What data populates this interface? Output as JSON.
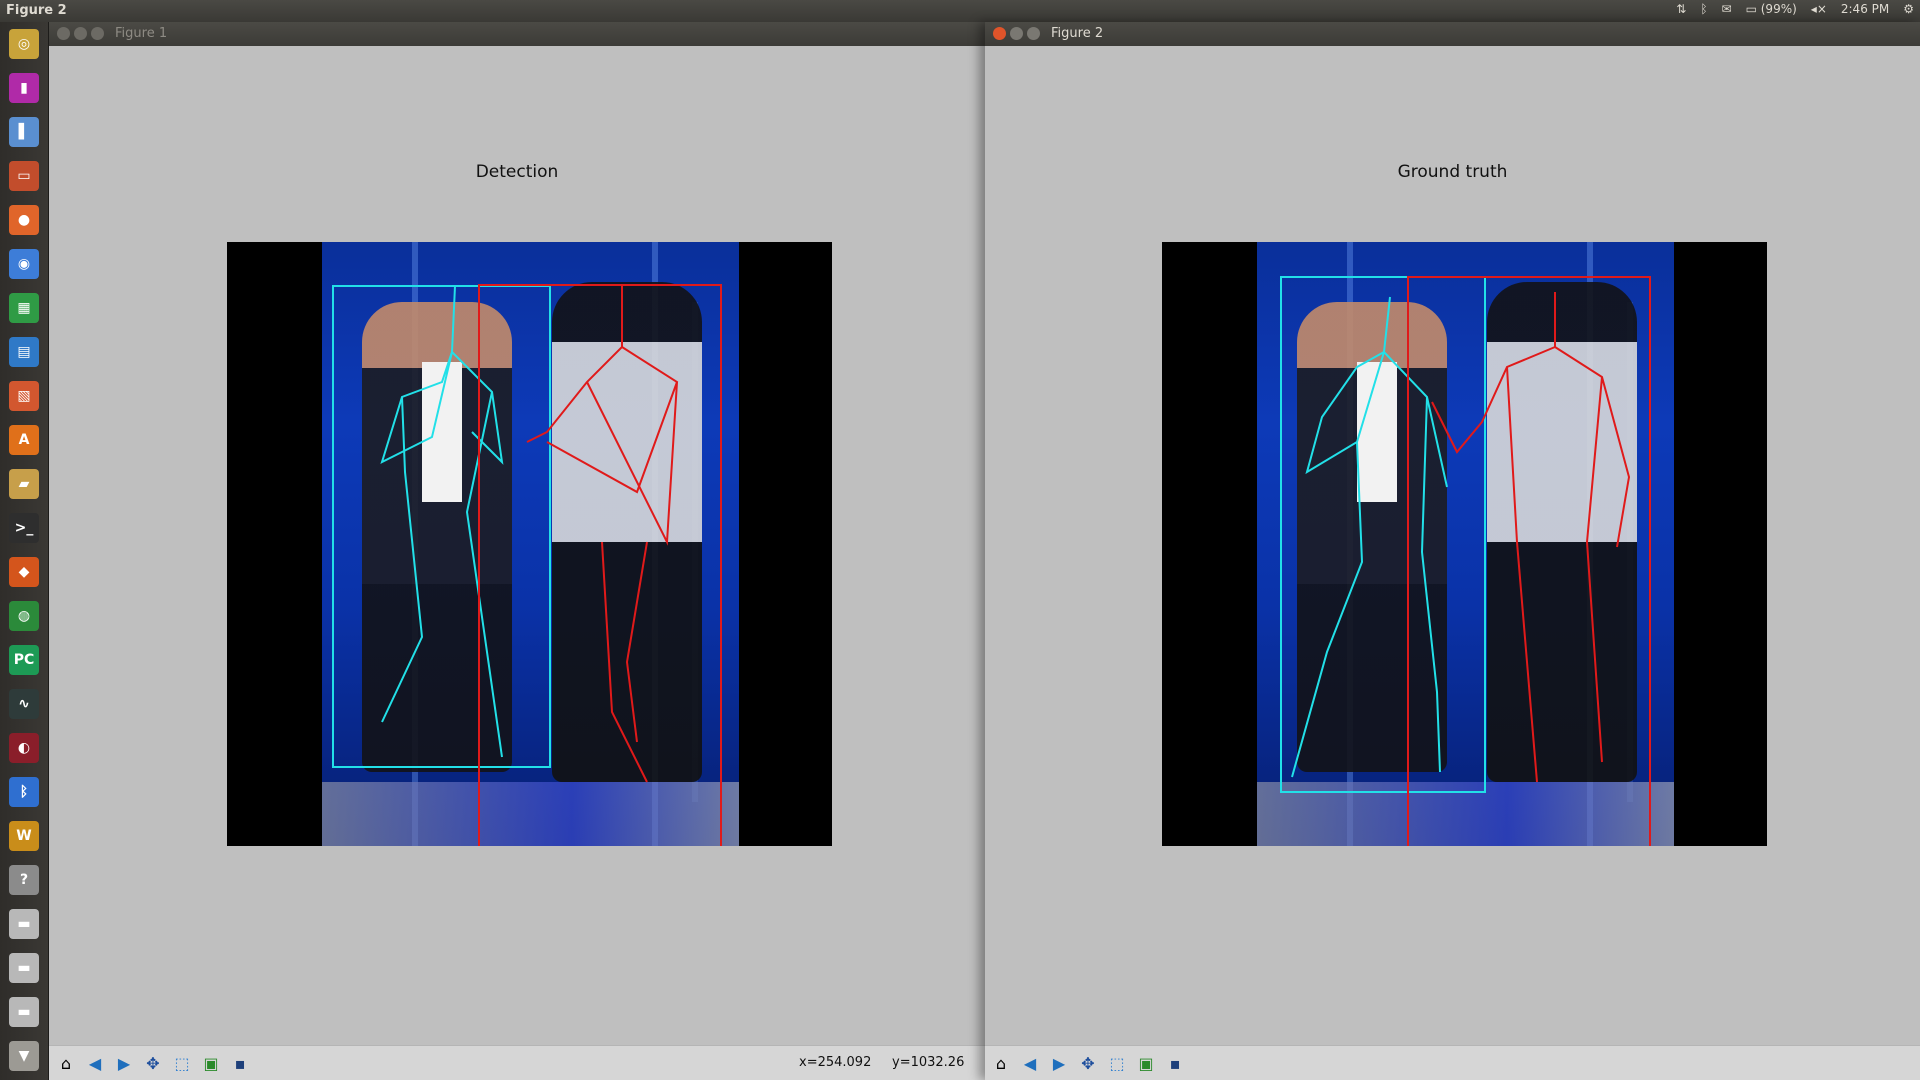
{
  "panel": {
    "app_title": "Figure 2",
    "battery": "(99%)",
    "time": "2:46 PM"
  },
  "launcher": {
    "items": [
      {
        "name": "ubuntu-dash",
        "color": "#c8a33a",
        "glyph": "◎"
      },
      {
        "name": "video-player",
        "color": "#b02aa8",
        "glyph": "▮"
      },
      {
        "name": "thermometer",
        "color": "#5a8fd0",
        "glyph": "▌"
      },
      {
        "name": "file-manager",
        "color": "#c24d2c",
        "glyph": "▭"
      },
      {
        "name": "firefox",
        "color": "#e0652a",
        "glyph": "●"
      },
      {
        "name": "chromium",
        "color": "#3d7dd8",
        "glyph": "◉"
      },
      {
        "name": "spreadsheet",
        "color": "#2f9b45",
        "glyph": "▦"
      },
      {
        "name": "writer",
        "color": "#2f79c7",
        "glyph": "▤"
      },
      {
        "name": "impress",
        "color": "#d2572f",
        "glyph": "▧"
      },
      {
        "name": "software-center",
        "color": "#e0701a",
        "glyph": "A"
      },
      {
        "name": "archive-manager",
        "color": "#c79f4a",
        "glyph": "▰"
      },
      {
        "name": "terminal",
        "color": "#2e2e2e",
        "glyph": ">_"
      },
      {
        "name": "matlab",
        "color": "#d4551c",
        "glyph": "◆"
      },
      {
        "name": "cpu-monitor",
        "color": "#2b8a3a",
        "glyph": "◍"
      },
      {
        "name": "pycharm",
        "color": "#1d9a55",
        "glyph": "PC"
      },
      {
        "name": "system-monitor",
        "color": "#2e3b3a",
        "glyph": "∿"
      },
      {
        "name": "media-app",
        "color": "#8a1e2a",
        "glyph": "◐"
      },
      {
        "name": "bluetooth",
        "color": "#2f6fd0",
        "glyph": "ᛒ"
      },
      {
        "name": "oscilloscope",
        "color": "#c98d1a",
        "glyph": "W"
      },
      {
        "name": "help",
        "color": "#8b8b8b",
        "glyph": "?"
      },
      {
        "name": "drive-1",
        "color": "#b8b8b8",
        "glyph": "▬"
      },
      {
        "name": "drive-2",
        "color": "#b8b8b8",
        "glyph": "▬"
      },
      {
        "name": "drive-3",
        "color": "#b8b8b8",
        "glyph": "▬"
      },
      {
        "name": "trash",
        "color": "#9c9a94",
        "glyph": "▼"
      }
    ]
  },
  "window1": {
    "title": "Figure 1",
    "plot_title": "Detection",
    "coord_x": "x=254.092",
    "coord_y": "y=1032.26"
  },
  "window2": {
    "title": "Figure 2",
    "plot_title": "Ground truth"
  },
  "colors": {
    "cyan": "#22e0e8",
    "red": "#e01a1a"
  }
}
